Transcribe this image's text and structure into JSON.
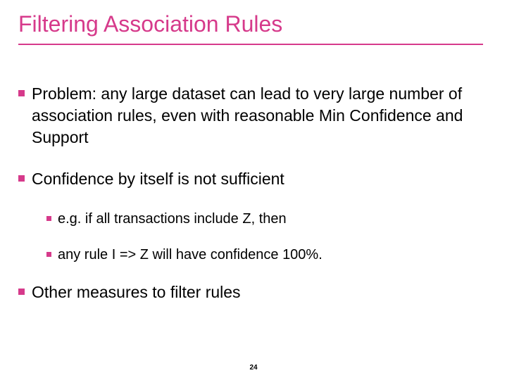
{
  "title": "Filtering Association Rules",
  "bullets": {
    "b1": "Problem: any large dataset can lead to very large number of association rules, even with reasonable Min Confidence and Support",
    "b2": "Confidence by itself is not sufficient",
    "b2a": "e.g. if all transactions include Z, then",
    "b2b": "any rule I => Z will have confidence 100%.",
    "b3": "Other measures to filter rules"
  },
  "page_number": "24"
}
